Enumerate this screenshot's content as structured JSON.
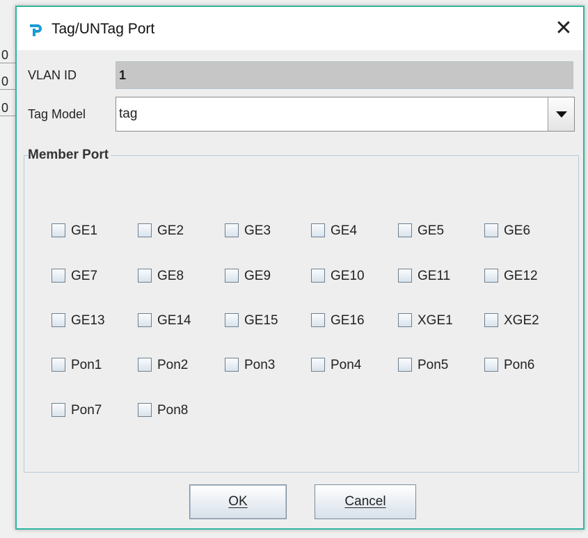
{
  "background": {
    "cells": [
      "0",
      "0",
      "0"
    ]
  },
  "dialog": {
    "title": "Tag/UNTag Port",
    "close_label": "✕",
    "vlan_id_label": "VLAN ID",
    "vlan_id_value": "1",
    "tag_model_label": "Tag Model",
    "tag_model_value": "tag",
    "member_port_title": "Member Port",
    "ports": [
      [
        "GE1",
        "GE2",
        "GE3",
        "GE4",
        "GE5",
        "GE6"
      ],
      [
        "GE7",
        "GE8",
        "GE9",
        "GE10",
        "GE11",
        "GE12"
      ],
      [
        "GE13",
        "GE14",
        "GE15",
        "GE16",
        "XGE1",
        "XGE2"
      ],
      [
        "Pon1",
        "Pon2",
        "Pon3",
        "Pon4",
        "Pon5",
        "Pon6"
      ],
      [
        "Pon7",
        "Pon8"
      ]
    ],
    "ok_label": "OK",
    "cancel_label": "Cancel"
  },
  "colors": {
    "accent_border": "#2fb5a0",
    "brand_icon": "#1a9ad6"
  }
}
